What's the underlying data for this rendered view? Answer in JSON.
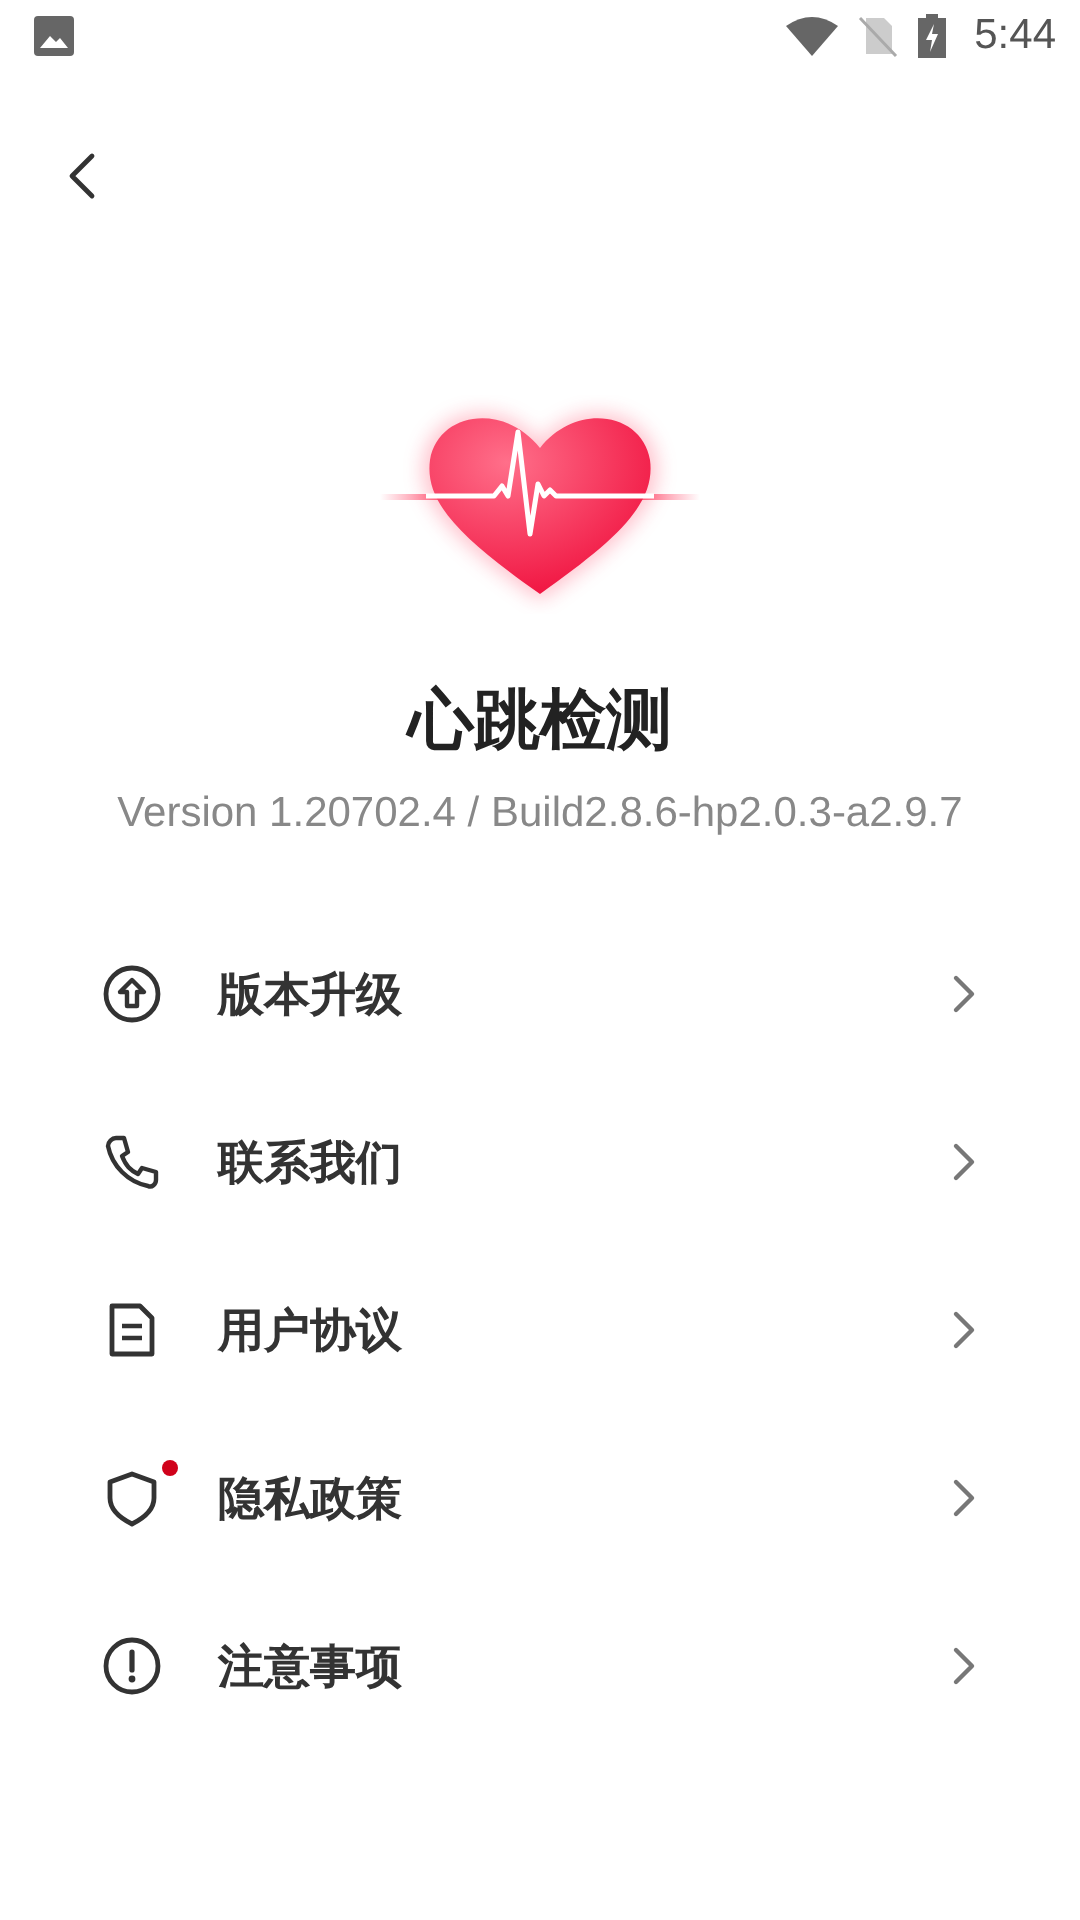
{
  "status_bar": {
    "time": "5:44"
  },
  "app": {
    "name": "心跳检测",
    "version": "Version 1.20702.4 / Build2.8.6-hp2.0.3-a2.9.7"
  },
  "menu": [
    {
      "kind": "upgrade",
      "label": "版本升级",
      "badge": false
    },
    {
      "kind": "phone",
      "label": "联系我们",
      "badge": false
    },
    {
      "kind": "document",
      "label": "用户协议",
      "badge": false
    },
    {
      "kind": "shield",
      "label": "隐私政策",
      "badge": true
    },
    {
      "kind": "warning",
      "label": "注意事项",
      "badge": false
    }
  ]
}
